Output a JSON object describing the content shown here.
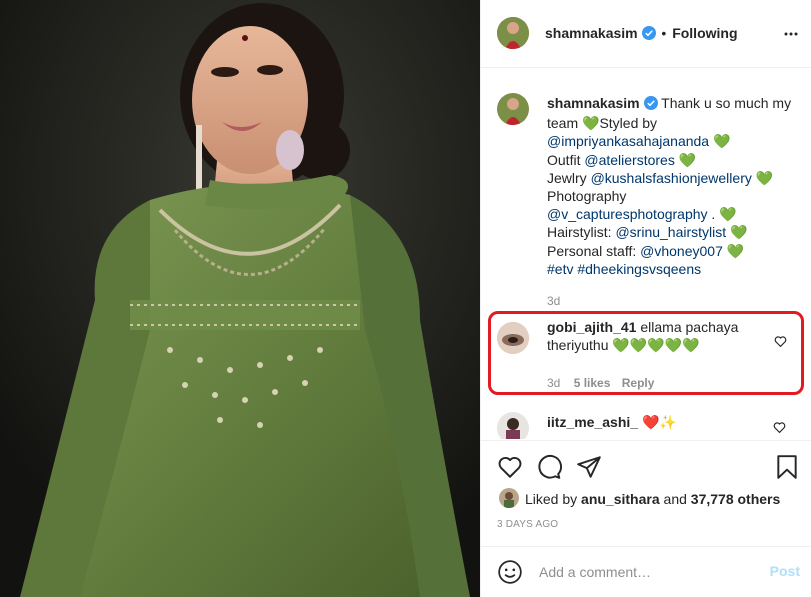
{
  "post": {
    "username": "shamnakasim",
    "follow_separator": "•",
    "follow_status": "Following"
  },
  "caption": {
    "username": "shamnakasim",
    "lines": [
      {
        "pre": "Thank u so much my team ",
        "mention": "",
        "post": "Styled by"
      },
      {
        "pre": "",
        "mention": "@impriyankasahajananda",
        "post": ""
      },
      {
        "pre": "Outfit ",
        "mention": "@atelierstores",
        "post": ""
      },
      {
        "pre": "Jewlry ",
        "mention": "@kushalsfashionjewellery",
        "post": ""
      },
      {
        "pre": "Photography",
        "mention": "",
        "post": ""
      },
      {
        "pre": "",
        "mention": "@v_capturesphotography",
        "post": " ."
      },
      {
        "pre": "Hairstylist: ",
        "mention": "@srinu_hairstylist",
        "post": ""
      },
      {
        "pre": "Personal staff: ",
        "mention": "@vhoney007",
        "post": ""
      },
      {
        "pre": "",
        "mention": "#etv #dheekingsvsqeens",
        "post": ""
      }
    ],
    "time": "3d"
  },
  "comments": [
    {
      "username": "gobi_ajith_41",
      "text_line1": "ellama pachaya",
      "text_line2": "theriyuthu",
      "emoji": "💚💚💚💚💚",
      "time": "3d",
      "likes": "5 likes",
      "reply": "Reply"
    },
    {
      "username": "iitz_me_ashi_",
      "emoji": "❤️✨"
    }
  ],
  "likes": {
    "prefix": "Liked by",
    "user": "anu_sithara",
    "joiner": "and",
    "others": "37,778 others"
  },
  "date": "3 DAYS AGO",
  "add_comment": {
    "placeholder": "Add a comment…",
    "post_label": "Post"
  },
  "colors": {
    "accent_blue": "#0095f6",
    "disabled_post": "#b2dffc",
    "highlight_border": "#e21a22",
    "heart_green": "#2fbf1e",
    "dress_green": "#6f8c48"
  }
}
